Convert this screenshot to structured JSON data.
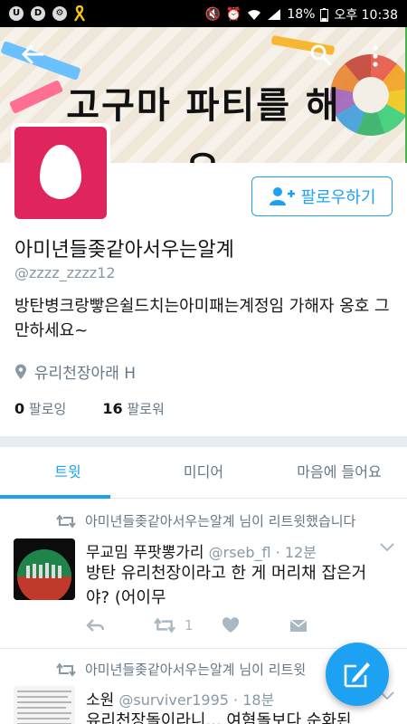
{
  "status_bar": {
    "battery": "18%",
    "time": "오후 10:38",
    "left_icons": [
      "u-icon",
      "d-icon",
      "gear-icon",
      "yellow-ribbon-icon"
    ],
    "right_icons": [
      "mute-icon",
      "alarm-icon",
      "wifi-icon",
      "signal-icon",
      "battery-icon"
    ]
  },
  "header": {
    "banner_text": "고구마 파티를 해요"
  },
  "profile": {
    "follow_label": "팔로우하기",
    "name": "아미년들좆같아서우는알계",
    "handle": "@zzzz_zzzz12",
    "bio": "방탄병크랑빻은쉴드치는아미패는계정임 가해자 옹호 그만하세요~",
    "location": "유리천장아래 H",
    "following_count": "0",
    "following_label": "팔로잉",
    "followers_count": "16",
    "followers_label": "팔로워"
  },
  "tabs": [
    {
      "label": "트윗",
      "active": true
    },
    {
      "label": "미디어",
      "active": false
    },
    {
      "label": "마음에 들어요",
      "active": false
    }
  ],
  "tweets": [
    {
      "retweet_text": "아미년들좆같아서우는알계 님이 리트윗했습니다",
      "name": "무교밈 푸팟뽕가리",
      "handle": "@rseb_fl · 12분",
      "text": "방탄 유리천장이라고 한 게 머리채 잡은거야? (어이무",
      "retweet_count": "1"
    },
    {
      "retweet_text": "아미년들좆같아서우는알계 님이 리트윗",
      "name": "소원",
      "handle": "@surviver1995 · 18분",
      "text": "유리천장돌이라니... 여혐돌보다 순화된"
    }
  ],
  "colors": {
    "accent": "#1da1f2",
    "avatar_bg": "#e0245e"
  }
}
